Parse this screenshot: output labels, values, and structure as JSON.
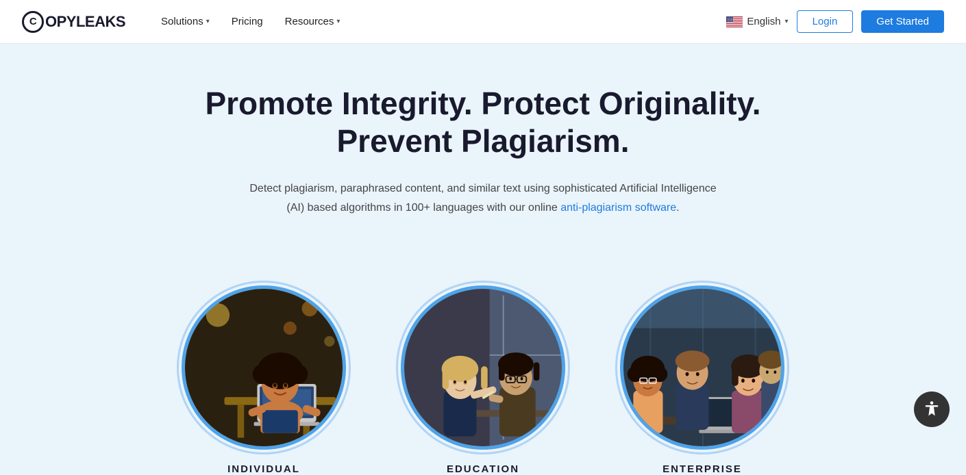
{
  "nav": {
    "logo_text": "OPYLEAKS",
    "logo_letter": "C",
    "links": [
      {
        "label": "Solutions",
        "has_dropdown": true
      },
      {
        "label": "Pricing",
        "has_dropdown": false
      },
      {
        "label": "Resources",
        "has_dropdown": true
      }
    ],
    "language": "English",
    "login_label": "Login",
    "get_started_label": "Get Started"
  },
  "hero": {
    "title": "Promote Integrity. Protect Originality. Prevent Plagiarism.",
    "subtitle_part1": "Detect plagiarism, paraphrased content, and similar text using sophisticated Artificial Intelligence (AI) based algorithms in 100+ languages with our online",
    "subtitle_link": "anti-plagiarism software",
    "subtitle_end": "."
  },
  "cards": [
    {
      "label": "INDIVIDUAL"
    },
    {
      "label": "EDUCATION"
    },
    {
      "label": "ENTERPRISE"
    }
  ],
  "accessibility": {
    "label": "Accessibility"
  }
}
